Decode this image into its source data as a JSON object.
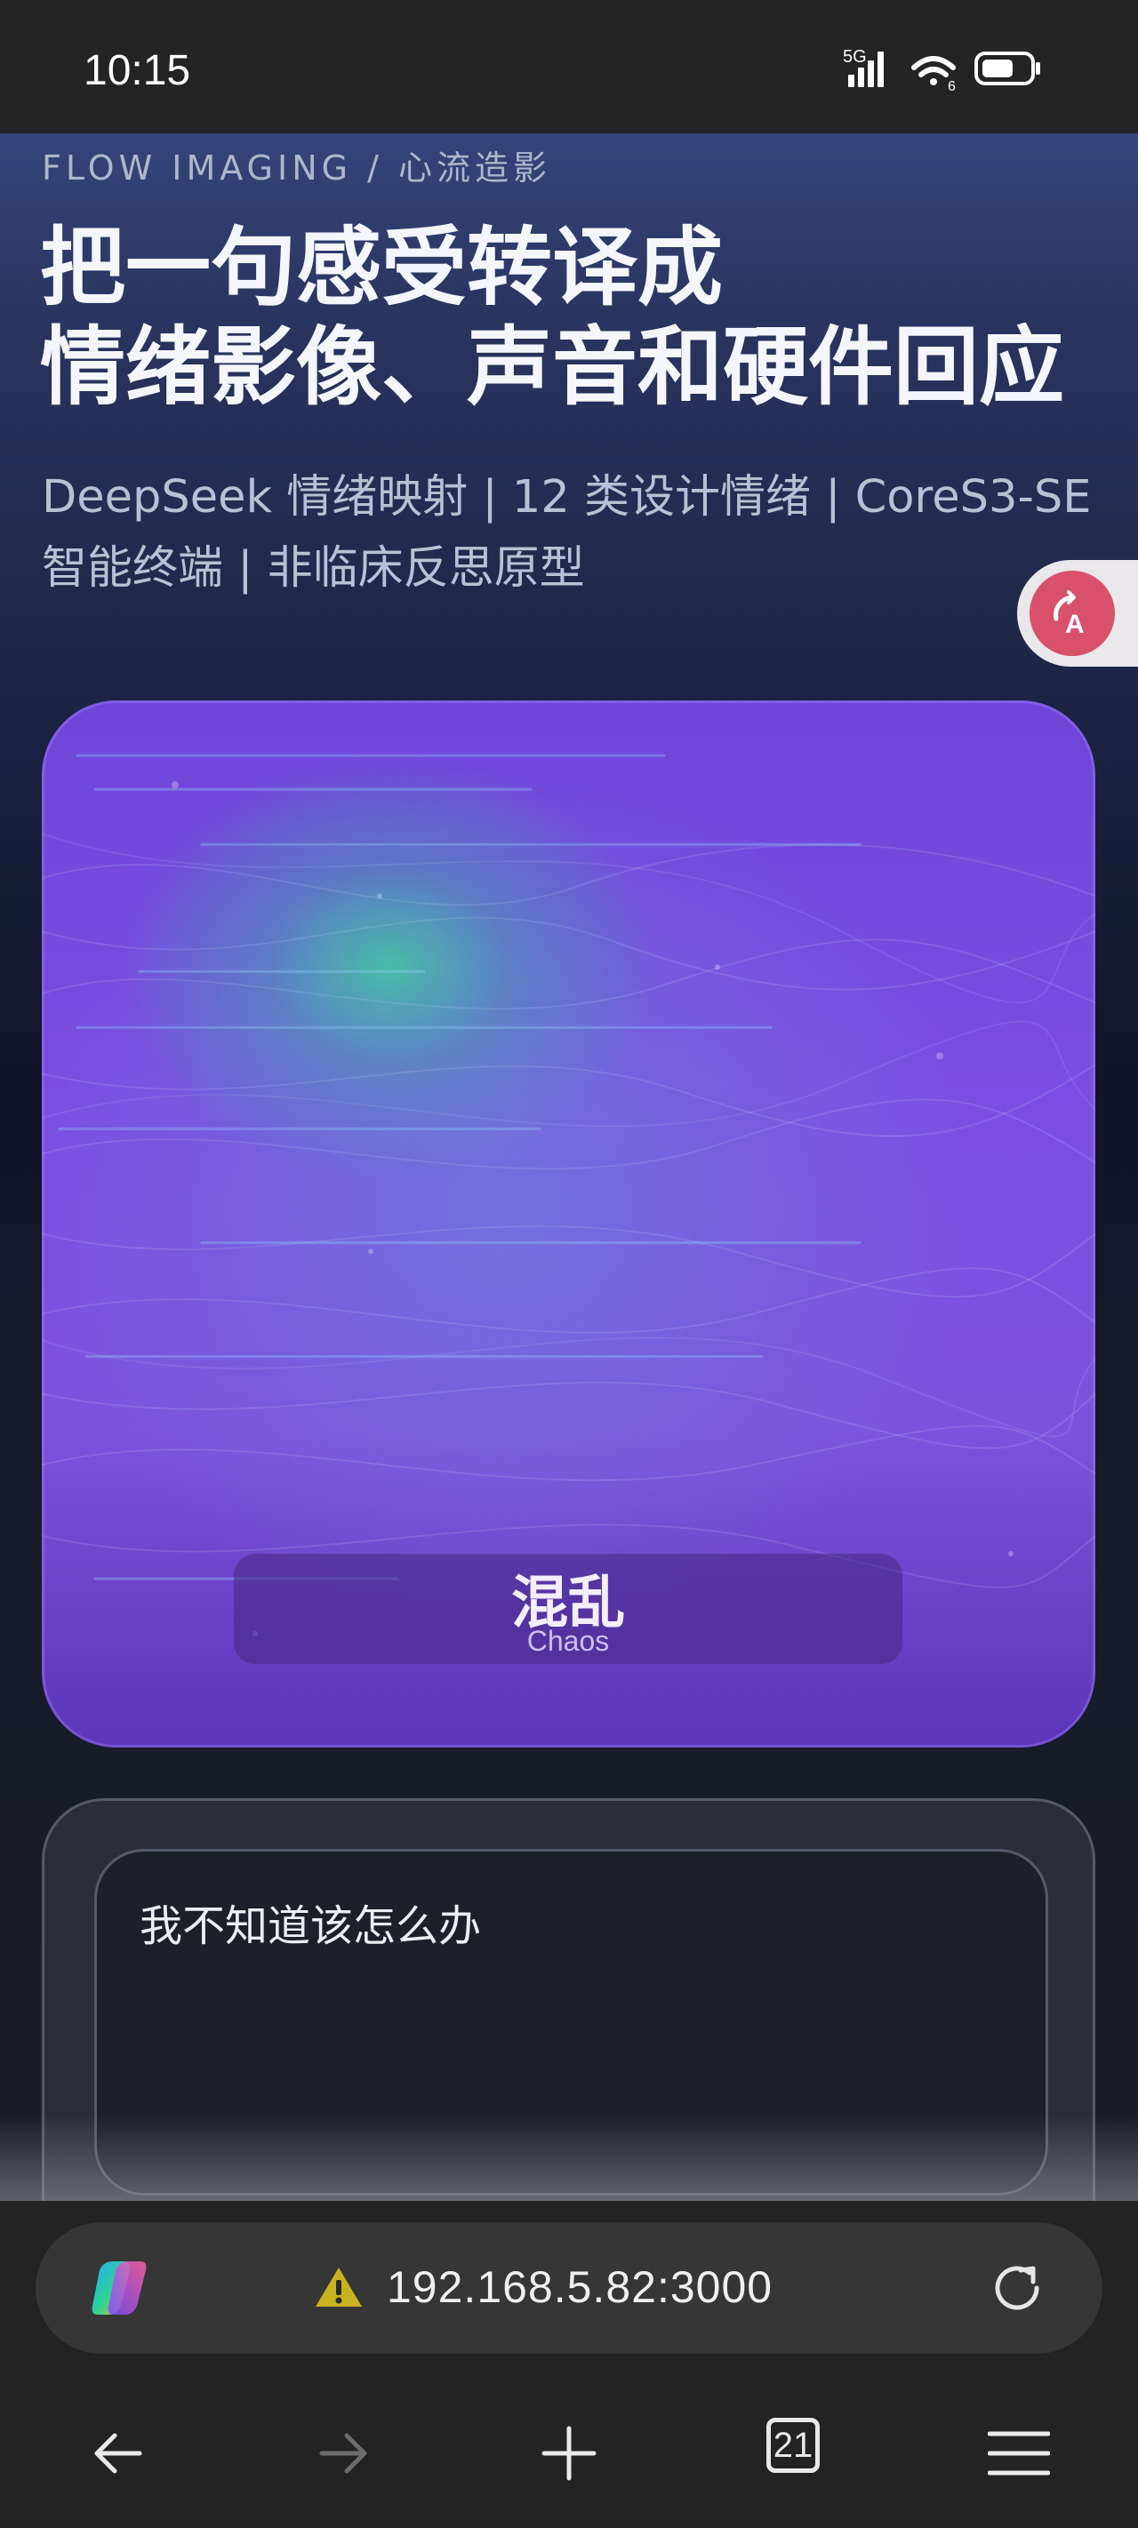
{
  "status_bar": {
    "time": "10:15",
    "network": "5G",
    "wifi_badge": "6",
    "icons": [
      "signal-icon",
      "wifi-icon",
      "battery-icon"
    ]
  },
  "page": {
    "eyebrow": "FLOW IMAGING / 心流造影",
    "headline_line1": "把一句感受转译成",
    "headline_line2": "情绪影像、声音和硬件回应",
    "subtitle_line1": "DeepSeek 情绪映射 | 12 类设计情绪 | CoreS3-SE",
    "subtitle_line2": "智能终端 | 非临床反思原型",
    "translate_icon": "translate-icon",
    "emotion": {
      "label_zh": "混乱",
      "label_en": "Chaos"
    },
    "input": {
      "value": "我不知道该怎么办"
    }
  },
  "browser": {
    "url": "192.168.5.82:3000",
    "insecure_icon": "warning-icon",
    "tab_count": "21",
    "nav": [
      "back-icon",
      "forward-icon",
      "new-tab-icon",
      "tabs-icon",
      "menu-icon"
    ]
  },
  "colors": {
    "accent_purple": "#7a4fe0",
    "glow_green": "#40cea0",
    "translate_fab": "#d9506b",
    "warning": "#c8b21e"
  }
}
